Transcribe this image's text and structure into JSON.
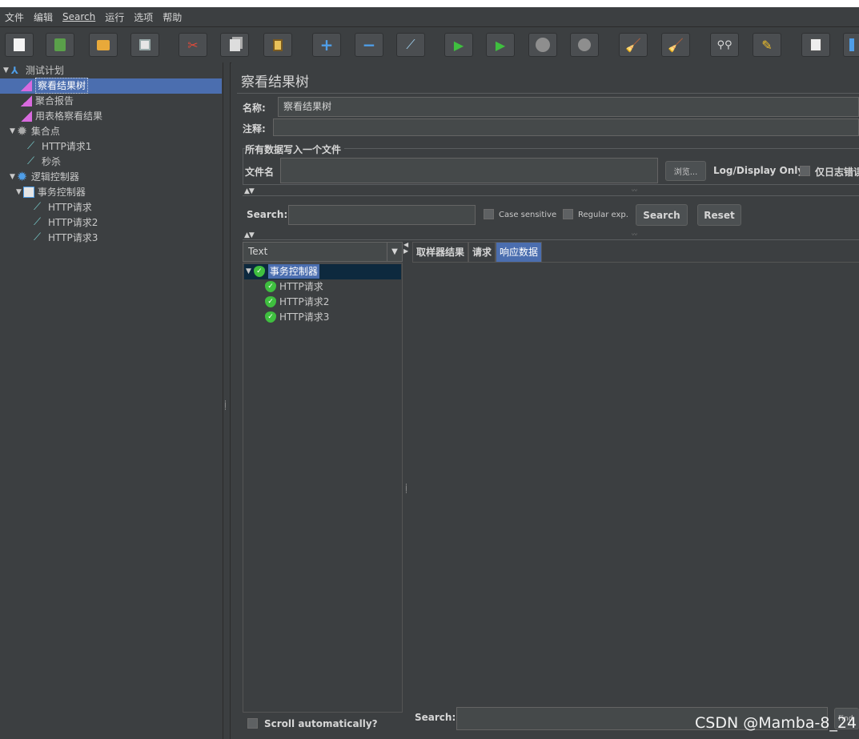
{
  "menu": {
    "items": [
      "文件",
      "编辑",
      "Search",
      "运行",
      "选项",
      "帮助"
    ]
  },
  "toolbar": {
    "buttons": [
      "new-icon",
      "template-icon",
      "open-icon",
      "save-icon",
      "cut-icon",
      "copy-icon",
      "paste-icon",
      "expand-icon",
      "collapse-icon",
      "toggle-icon",
      "start-icon",
      "start-no-pause-icon",
      "stop-icon",
      "shutdown-icon",
      "clear-icon",
      "clear-all-icon",
      "search-icon",
      "reset-search-icon",
      "function-helper-icon",
      "help-icon"
    ]
  },
  "tree": {
    "items": [
      {
        "label": "测试计划",
        "icon": "test-plan-icon"
      },
      {
        "label": "察看结果树",
        "icon": "listener-icon",
        "selected": true
      },
      {
        "label": "聚合报告",
        "icon": "listener-icon"
      },
      {
        "label": "用表格察看结果",
        "icon": "listener-icon"
      },
      {
        "label": "集合点",
        "icon": "gear-icon"
      },
      {
        "label": "HTTP请求1",
        "icon": "sampler-icon"
      },
      {
        "label": "秒杀",
        "icon": "sampler-icon"
      },
      {
        "label": "逻辑控制器",
        "icon": "gear-icon"
      },
      {
        "label": "事务控制器",
        "icon": "controller-icon"
      },
      {
        "label": "HTTP请求",
        "icon": "sampler-icon"
      },
      {
        "label": "HTTP请求2",
        "icon": "sampler-icon"
      },
      {
        "label": "HTTP请求3",
        "icon": "sampler-icon"
      }
    ]
  },
  "panel": {
    "title": "察看结果树",
    "name_label": "名称:",
    "name_value": "察看结果树",
    "comment_label": "注释:",
    "comment_value": "",
    "file_section": "所有数据写入一个文件",
    "filename_label": "文件名",
    "filename_value": "",
    "browse_label": "浏览...",
    "log_display_label": "Log/Display Only:",
    "errors_only_label": "仅日志错误"
  },
  "search": {
    "label": "Search:",
    "value": "",
    "case_sensitive": "Case sensitive",
    "regular_exp": "Regular exp.",
    "search_button": "Search",
    "reset_button": "Reset"
  },
  "results": {
    "renderer": "Text",
    "tree": [
      {
        "label": "事务控制器"
      },
      {
        "label": "HTTP请求"
      },
      {
        "label": "HTTP请求2"
      },
      {
        "label": "HTTP请求3"
      }
    ],
    "tabs": [
      "取样器结果",
      "请求",
      "响应数据"
    ],
    "active_tab": "响应数据",
    "scroll_auto": "Scroll automatically?",
    "bottom_search_label": "Search:",
    "find_label": "Find"
  },
  "watermark": "CSDN @Mamba-8_24"
}
